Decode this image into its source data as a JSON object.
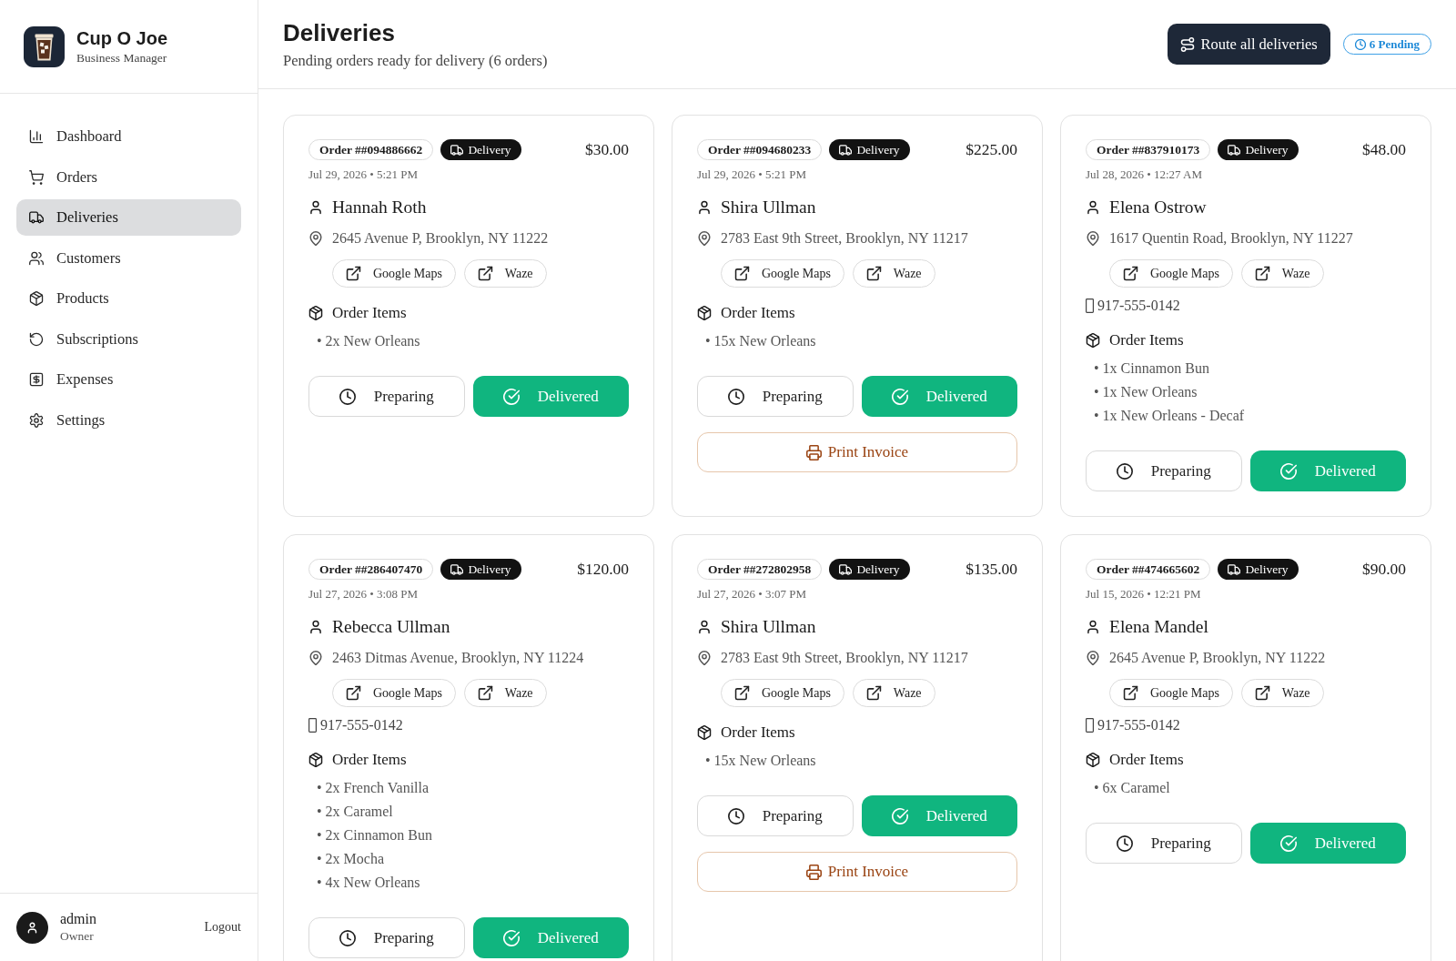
{
  "sidebar": {
    "brand": {
      "name": "Cup O Joe",
      "subtitle": "Business Manager"
    },
    "nav_items": [
      {
        "label": "Dashboard",
        "selected": false
      },
      {
        "label": "Orders",
        "selected": false
      },
      {
        "label": "Deliveries",
        "selected": true
      },
      {
        "label": "Customers",
        "selected": false
      },
      {
        "label": "Products",
        "selected": false
      },
      {
        "label": "Subscriptions",
        "selected": false
      },
      {
        "label": "Expenses",
        "selected": false
      },
      {
        "label": "Settings",
        "selected": false
      }
    ],
    "user": {
      "name": "admin",
      "role": "Owner",
      "logout": "Logout"
    }
  },
  "header": {
    "title": "Deliveries",
    "subtitle": "Pending orders ready for delivery (6 orders)",
    "route_button": "Route all deliveries",
    "pending_badge": "6 Pending"
  },
  "orders": [
    {
      "order_number": "Order ##094886662",
      "type_badge": "Delivery",
      "total": "$30.00",
      "date": "Jul 29, 2026 • 5:21 PM",
      "customer": "Hannah Roth",
      "address": "2645 Avenue P, Brooklyn, NY 11222",
      "map_links": [
        "Google Maps",
        "Waze"
      ],
      "items_heading": "Order Items",
      "items": [
        "• 2x New Orleans"
      ],
      "actions": [
        {
          "label": "Preparing",
          "kind": "outline"
        },
        {
          "label": "Delivered",
          "kind": "primary"
        }
      ]
    },
    {
      "order_number": "Order ##094680233",
      "type_badge": "Delivery",
      "total": "$225.00",
      "date": "Jul 29, 2026 • 5:21 PM",
      "customer": "Shira Ullman",
      "address": "2783 East 9th Street, Brooklyn, NY 11217",
      "map_links": [
        "Google Maps",
        "Waze"
      ],
      "items_heading": "Order Items",
      "items": [
        "• 15x New Orleans"
      ],
      "actions": [
        {
          "label": "Preparing",
          "kind": "outline"
        },
        {
          "label": "Delivered",
          "kind": "primary"
        }
      ],
      "invoice_button": "Print Invoice"
    },
    {
      "order_number": "Order ##837910173",
      "type_badge": "Delivery",
      "total": "$48.00",
      "date": "Jul 28, 2026 • 12:27 AM",
      "customer": "Elena Ostrow",
      "address": "1617 Quentin Road, Brooklyn, NY 11227",
      "map_links": [
        "Google Maps",
        "Waze"
      ],
      "phone": "917-555-0142",
      "items_heading": "Order Items",
      "items": [
        "• 1x Cinnamon Bun",
        "• 1x New Orleans",
        "• 1x New Orleans - Decaf"
      ],
      "actions": [
        {
          "label": "Preparing",
          "kind": "outline"
        },
        {
          "label": "Delivered",
          "kind": "primary"
        }
      ]
    },
    {
      "order_number": "Order ##286407470",
      "type_badge": "Delivery",
      "total": "$120.00",
      "date": "Jul 27, 2026 • 3:08 PM",
      "customer": "Rebecca Ullman",
      "address": "2463 Ditmas Avenue, Brooklyn, NY 11224",
      "map_links": [
        "Google Maps",
        "Waze"
      ],
      "phone": "917-555-0142",
      "items_heading": "Order Items",
      "items": [
        "• 2x French Vanilla",
        "• 2x Caramel",
        "• 2x Cinnamon Bun",
        "• 2x Mocha",
        "• 4x New Orleans"
      ],
      "actions": [
        {
          "label": "Preparing",
          "kind": "outline"
        },
        {
          "label": "Delivered",
          "kind": "primary"
        }
      ]
    },
    {
      "order_number": "Order ##272802958",
      "type_badge": "Delivery",
      "total": "$135.00",
      "date": "Jul 27, 2026 • 3:07 PM",
      "customer": "Shira Ullman",
      "address": "2783 East 9th Street, Brooklyn, NY 11217",
      "map_links": [
        "Google Maps",
        "Waze"
      ],
      "items_heading": "Order Items",
      "items": [
        "• 15x New Orleans"
      ],
      "actions": [
        {
          "label": "Preparing",
          "kind": "outline"
        },
        {
          "label": "Delivered",
          "kind": "primary"
        }
      ],
      "invoice_button": "Print Invoice"
    },
    {
      "order_number": "Order ##474665602",
      "type_badge": "Delivery",
      "total": "$90.00",
      "date": "Jul 15, 2026 • 12:21 PM",
      "customer": "Elena Mandel",
      "address": "2645 Avenue P, Brooklyn, NY 11222",
      "map_links": [
        "Google Maps",
        "Waze"
      ],
      "phone": "917-555-0142",
      "items_heading": "Order Items",
      "items": [
        "• 6x Caramel"
      ],
      "actions": [
        {
          "label": "Preparing",
          "kind": "outline"
        },
        {
          "label": "Delivered",
          "kind": "primary"
        }
      ]
    }
  ]
}
